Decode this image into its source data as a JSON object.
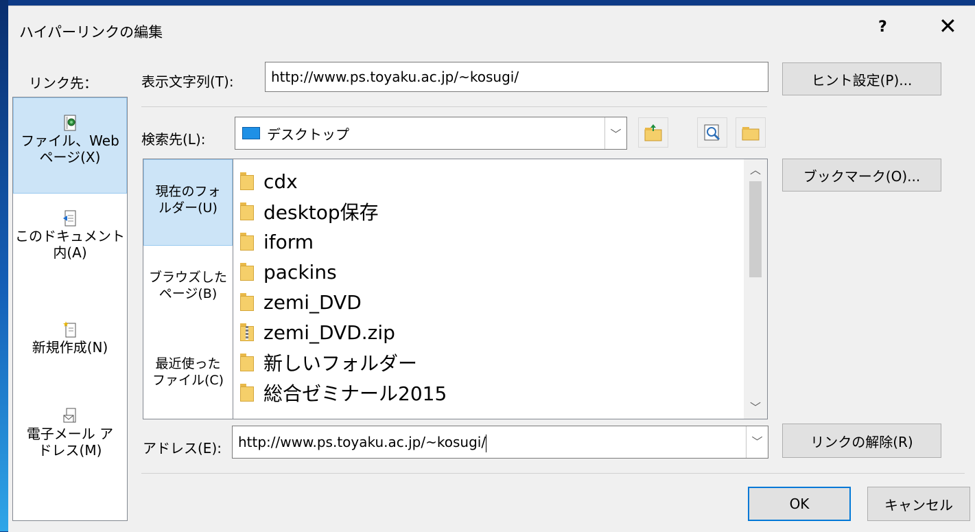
{
  "window": {
    "title": "ハイパーリンクの編集",
    "help_label": "?",
    "close_label": "✕"
  },
  "link_to": {
    "label": "リンク先：",
    "items": [
      {
        "line1": "ファイル、Web",
        "line2": "ページ(X)",
        "icon": "web-page-icon",
        "selected": true
      },
      {
        "line1": "このドキュメント",
        "line2": "内(A)",
        "icon": "document-place-icon",
        "selected": false
      },
      {
        "line1": "新規作成(N)",
        "line2": "",
        "icon": "new-document-icon",
        "selected": false
      },
      {
        "line1": "電子メール ア",
        "line2": "ドレス(M)",
        "icon": "email-icon",
        "selected": false
      }
    ]
  },
  "text_to_display": {
    "label": "表示文字列(T):",
    "value": "http://www.ps.toyaku.ac.jp/~kosugi/"
  },
  "screentip_button": "ヒント設定(P)...",
  "look_in": {
    "label": "検索先(L):",
    "value": "デスクトップ",
    "icon": "desktop-icon"
  },
  "tools": {
    "up_folder_icon": "up-folder-icon",
    "browse_web_icon": "browse-web-icon",
    "browse_file_icon": "browse-file-icon"
  },
  "look_in_pane": [
    {
      "line1": "現在のフォ",
      "line2": "ルダー(U)",
      "selected": true
    },
    {
      "line1": "ブラウズした",
      "line2": "ページ(B)",
      "selected": false
    },
    {
      "line1": "最近使った",
      "line2": "ファイル(C)",
      "selected": false
    }
  ],
  "files": [
    {
      "name": "cdx",
      "type": "folder"
    },
    {
      "name": "desktop保存",
      "type": "folder"
    },
    {
      "name": "iform",
      "type": "folder"
    },
    {
      "name": "packins",
      "type": "folder"
    },
    {
      "name": "zemi_DVD",
      "type": "folder"
    },
    {
      "name": "zemi_DVD.zip",
      "type": "zip"
    },
    {
      "name": "新しいフォルダー",
      "type": "folder"
    },
    {
      "name": "総合ゼミナール2015",
      "type": "folder"
    }
  ],
  "bookmark_button": "ブックマーク(O)...",
  "address": {
    "label": "アドレス(E):",
    "value": "http://www.ps.toyaku.ac.jp/~kosugi/"
  },
  "remove_link_button": "リンクの解除(R)",
  "ok_button": "OK",
  "cancel_button": "キャンセル",
  "colors": {
    "selection": "#cce4f7",
    "selection_border": "#99c9ef",
    "default_button_border": "#0078d7",
    "folder": "#f5cf6a"
  }
}
